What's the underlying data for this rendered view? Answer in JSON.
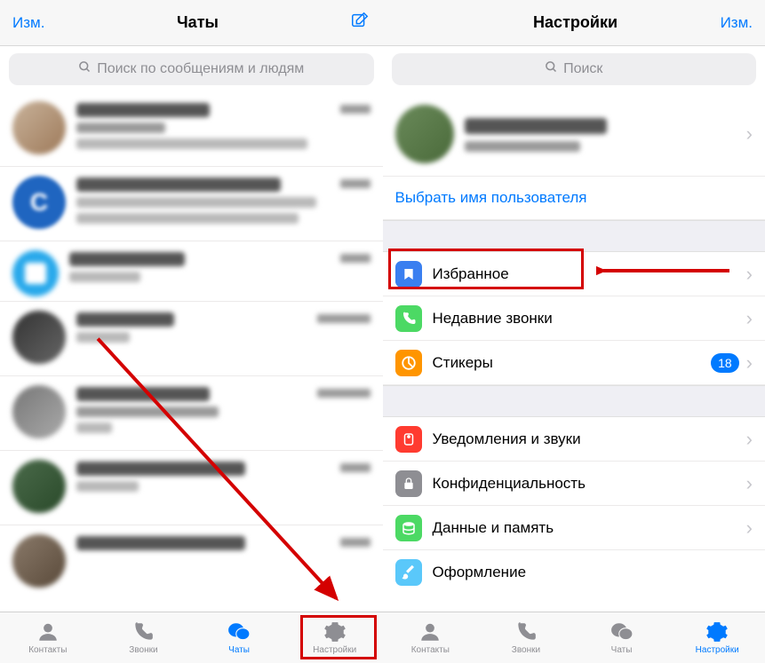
{
  "left": {
    "header": {
      "edit": "Изм.",
      "title": "Чаты"
    },
    "search_placeholder": "Поиск по сообщениям и людям",
    "tabs": {
      "contacts": "Контакты",
      "calls": "Звонки",
      "chats": "Чаты",
      "settings": "Настройки"
    }
  },
  "right": {
    "header": {
      "title": "Настройки",
      "edit": "Изм."
    },
    "search_placeholder": "Поиск",
    "username_link": "Выбрать имя пользователя",
    "cells": {
      "saved": "Избранное",
      "recent_calls": "Недавние звонки",
      "stickers": "Стикеры",
      "stickers_badge": "18",
      "notifications": "Уведомления и звуки",
      "privacy": "Конфиденциальность",
      "data": "Данные и память",
      "appearance": "Оформление"
    },
    "tabs": {
      "contacts": "Контакты",
      "calls": "Звонки",
      "chats": "Чаты",
      "settings": "Настройки"
    }
  }
}
